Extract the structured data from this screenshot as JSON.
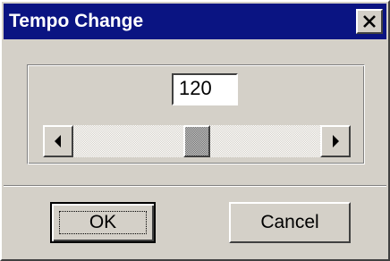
{
  "window": {
    "title": "Tempo Change",
    "close_icon": "close-icon"
  },
  "tempo": {
    "value": "120",
    "slider": {
      "position_fraction": 0.5,
      "left_arrow_icon": "arrow-left-icon",
      "right_arrow_icon": "arrow-right-icon"
    }
  },
  "buttons": {
    "ok_label": "OK",
    "cancel_label": "Cancel"
  },
  "colors": {
    "titlebar": "#0a1482",
    "face": "#d4d0c8"
  }
}
